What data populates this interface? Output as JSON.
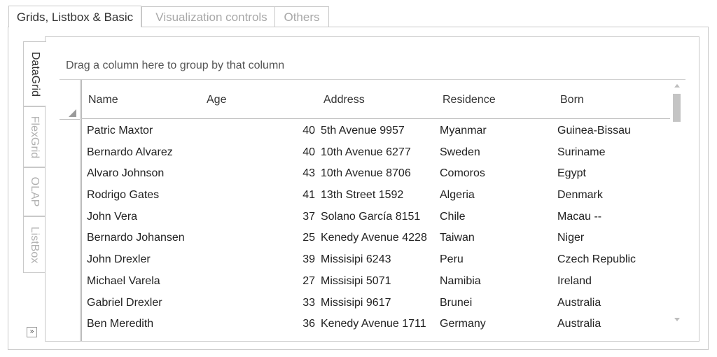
{
  "top_tabs": [
    {
      "label": "Grids, Listbox & Basic",
      "active": true
    },
    {
      "label": "Visualization controls",
      "active": false
    },
    {
      "label": "Others",
      "active": false
    }
  ],
  "side_tabs": [
    {
      "label": "DataGrid",
      "active": true
    },
    {
      "label": "FlexGrid",
      "active": false
    },
    {
      "label": "OLAP",
      "active": false
    },
    {
      "label": "ListBox",
      "active": false
    }
  ],
  "side_expand_glyph": "»",
  "grid": {
    "group_hint": "Drag a column here to group by that column",
    "columns": [
      "Name",
      "Age",
      "Address",
      "Residence",
      "Born"
    ],
    "rows": [
      {
        "name": "Patric Maxtor",
        "age": "40",
        "address": "5th Avenue 9957",
        "residence": "Myanmar",
        "born": "Guinea-Bissau"
      },
      {
        "name": "Bernardo Alvarez",
        "age": "40",
        "address": "10th Avenue 6277",
        "residence": "Sweden",
        "born": "Suriname"
      },
      {
        "name": "Alvaro Johnson",
        "age": "43",
        "address": "10th Avenue 8706",
        "residence": "Comoros",
        "born": "Egypt"
      },
      {
        "name": "Rodrigo Gates",
        "age": "41",
        "address": "13th Street 1592",
        "residence": "Algeria",
        "born": "Denmark"
      },
      {
        "name": "John Vera",
        "age": "37",
        "address": "Solano García 8151",
        "residence": "Chile",
        "born": "Macau --"
      },
      {
        "name": "Bernardo Johansen",
        "age": "25",
        "address": "Kenedy Avenue 4228",
        "residence": "Taiwan",
        "born": "Niger"
      },
      {
        "name": "John Drexler",
        "age": "39",
        "address": "Missisipi 6243",
        "residence": "Peru",
        "born": "Czech Republic"
      },
      {
        "name": "Michael Varela",
        "age": "27",
        "address": "Missisipi 5071",
        "residence": "Namibia",
        "born": "Ireland"
      },
      {
        "name": "Gabriel Drexler",
        "age": "33",
        "address": "Missisipi 9617",
        "residence": "Brunei",
        "born": "Australia"
      },
      {
        "name": "Ben Meredith",
        "age": "36",
        "address": "Kenedy Avenue 1711",
        "residence": "Germany",
        "born": "Australia"
      }
    ]
  }
}
